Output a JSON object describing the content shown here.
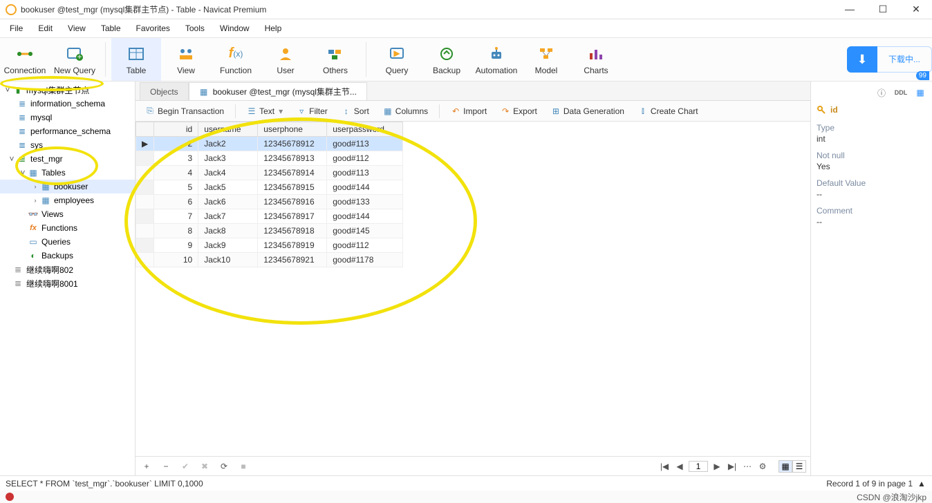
{
  "title": "bookuser @test_mgr (mysql集群主节点) - Table - Navicat Premium",
  "menus": [
    "File",
    "Edit",
    "View",
    "Table",
    "Favorites",
    "Tools",
    "Window",
    "Help"
  ],
  "toolbar": [
    {
      "id": "connection",
      "label": "Connection"
    },
    {
      "id": "new-query",
      "label": "New Query"
    },
    {
      "id": "table",
      "label": "Table"
    },
    {
      "id": "view",
      "label": "View"
    },
    {
      "id": "function",
      "label": "Function"
    },
    {
      "id": "user",
      "label": "User"
    },
    {
      "id": "others",
      "label": "Others"
    },
    {
      "id": "query",
      "label": "Query"
    },
    {
      "id": "backup",
      "label": "Backup"
    },
    {
      "id": "automation",
      "label": "Automation"
    },
    {
      "id": "model",
      "label": "Model"
    },
    {
      "id": "charts",
      "label": "Charts"
    }
  ],
  "download_label": "下载中...",
  "badge": "99",
  "tree": {
    "conn1": "mysql集群主节点",
    "db1": "information_schema",
    "db2": "mysql",
    "db3": "performance_schema",
    "db4": "sys",
    "db5": "test_mgr",
    "tables_label": "Tables",
    "tbl1": "bookuser",
    "tbl2": "employees",
    "views_label": "Views",
    "functions_label": "Functions",
    "queries_label": "Queries",
    "backups_label": "Backups",
    "host1": "继续嗨啊802",
    "host2": "继续嗨啊8001"
  },
  "tabs": {
    "objects": "Objects",
    "tab2": "bookuser @test_mgr (mysql集群主节..."
  },
  "subtool": {
    "begin": "Begin Transaction",
    "text": "Text",
    "filter": "Filter",
    "sort": "Sort",
    "columns": "Columns",
    "import": "Import",
    "export": "Export",
    "datagen": "Data Generation",
    "chart": "Create Chart"
  },
  "columns": [
    "id",
    "username",
    "userphone",
    "userpassword"
  ],
  "rows": [
    {
      "id": "2",
      "username": "Jack2",
      "userphone": "12345678912",
      "userpassword": "good#113",
      "sel": true
    },
    {
      "id": "3",
      "username": "Jack3",
      "userphone": "12345678913",
      "userpassword": "good#112"
    },
    {
      "id": "4",
      "username": "Jack4",
      "userphone": "12345678914",
      "userpassword": "good#113"
    },
    {
      "id": "5",
      "username": "Jack5",
      "userphone": "12345678915",
      "userpassword": "good#144"
    },
    {
      "id": "6",
      "username": "Jack6",
      "userphone": "12345678916",
      "userpassword": "good#133"
    },
    {
      "id": "7",
      "username": "Jack7",
      "userphone": "12345678917",
      "userpassword": "good#144"
    },
    {
      "id": "8",
      "username": "Jack8",
      "userphone": "12345678918",
      "userpassword": "good#145"
    },
    {
      "id": "9",
      "username": "Jack9",
      "userphone": "12345678919",
      "userpassword": "good#112"
    },
    {
      "id": "10",
      "username": "Jack10",
      "userphone": "12345678921",
      "userpassword": "good#1178"
    }
  ],
  "gridfoot": {
    "add": "+",
    "del": "−",
    "ok": "✔",
    "cancel": "✖",
    "refresh": "⟳",
    "stop": "■"
  },
  "pager": {
    "first": "|◀",
    "prev": "◀",
    "page": "1",
    "next": "▶",
    "last": "▶|",
    "opts": "⋯",
    "gear": "⚙"
  },
  "status": {
    "sql": "SELECT * FROM `test_mgr`.`bookuser` LIMIT 0,1000",
    "records": "Record 1 of 9 in page 1"
  },
  "watermark": "CSDN @浪淘沙jkp",
  "props": {
    "title": "id",
    "type_l": "Type",
    "type_v": "int",
    "nn_l": "Not null",
    "nn_v": "Yes",
    "def_l": "Default Value",
    "def_v": "--",
    "com_l": "Comment",
    "com_v": "--"
  }
}
